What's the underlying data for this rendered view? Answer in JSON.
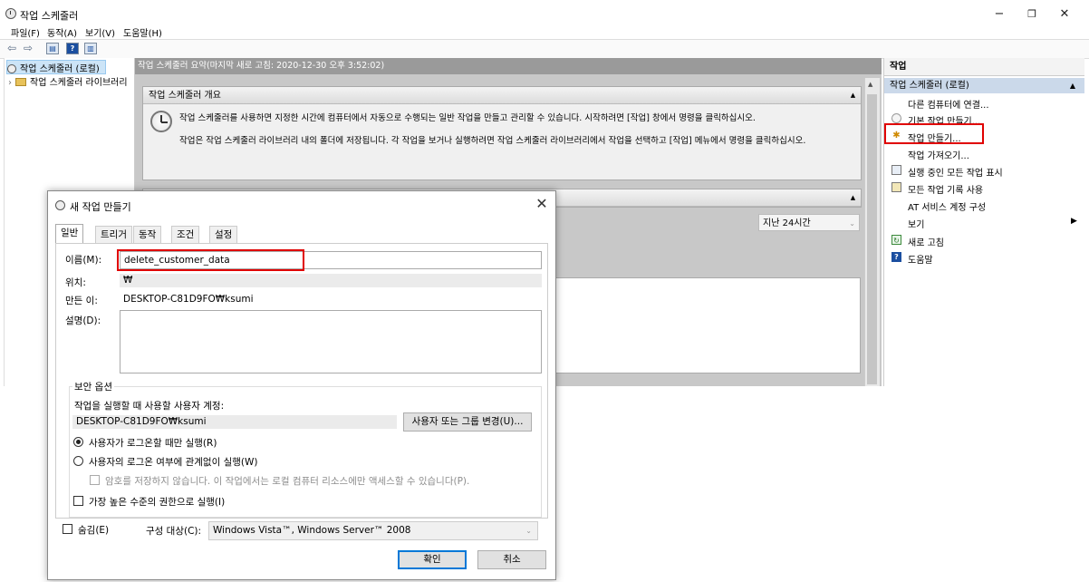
{
  "window": {
    "title": "작업 스케줄러",
    "minimize": "−",
    "restore": "❐",
    "close": "✕"
  },
  "menu": [
    "파일(F)",
    "동작(A)",
    "보기(V)",
    "도움말(H)"
  ],
  "toolbar": {
    "back_icon": "arrow-left",
    "forward_icon": "arrow-right",
    "view_icon": "console-tree",
    "help_icon": "help",
    "panel_icon": "action-pane"
  },
  "tree": {
    "items": [
      {
        "label": "작업 스케줄러 (로컬)",
        "selected": true
      },
      {
        "label": "작업 스케줄러 라이브러리",
        "expander": "›"
      }
    ]
  },
  "center": {
    "header": "작업 스케줄러 요약(마지막 새로 고침: 2020-12-30 오후 3:52:02)",
    "overview": {
      "title": "작업 스케줄러 개요",
      "line1": "작업 스케줄러를 사용하면 지정한 시간에 컴퓨터에서 자동으로 수행되는 일반 작업을 만들고 관리할 수 있습니다. 시작하려면 [작업] 창에서 명령을 클릭하십시오.",
      "line2": "작업은 작업 스케줄러 라이브러리 내의 폴더에 저장됩니다. 각 작업을 보거나 실행하려면 작업 스케줄러 라이브러리에서 작업을 선택하고 [작업] 메뉴에서 명령을 클릭하십시오."
    },
    "period": "지난 24시간",
    "collapse_glyph": "▲"
  },
  "actions": {
    "header": "작업",
    "subheader": "작업 스케줄러 (로컬)",
    "items": [
      {
        "label": "다른 컴퓨터에 연결...",
        "icon": ""
      },
      {
        "label": "기본 작업 만들기...",
        "icon": "basic-task-icon"
      },
      {
        "label": "작업 만들기...",
        "icon": "create-task-icon",
        "highlighted": true
      },
      {
        "label": "작업 가져오기...",
        "icon": ""
      },
      {
        "label": "실행 중인 모든 작업 표시",
        "icon": "running-tasks-icon"
      },
      {
        "label": "모든 작업 기록 사용",
        "icon": "history-icon"
      },
      {
        "label": "AT 서비스 계정 구성",
        "icon": ""
      },
      {
        "label": "보기",
        "icon": "",
        "submenu": "▶"
      },
      {
        "label": "새로 고침",
        "icon": "refresh-icon"
      },
      {
        "label": "도움말",
        "icon": "help-icon"
      }
    ]
  },
  "dialog": {
    "title": "새 작업 만들기",
    "close": "✕",
    "tabs": [
      "일반",
      "트리거",
      "동작",
      "조건",
      "설정"
    ],
    "name_label": "이름(M):",
    "name_value": "delete_customer_data",
    "location_label": "위치:",
    "location_value": "₩",
    "author_label": "만든 이:",
    "author_value": "DESKTOP-C81D9FO₩ksumi",
    "description_label": "설명(D):",
    "description_value": "",
    "security": {
      "title": "보안 옵션",
      "account_label": "작업을 실행할 때 사용할 사용자 계정:",
      "account_value": "DESKTOP-C81D9FO₩ksumi",
      "change_button": "사용자 또는 그룹 변경(U)...",
      "radio_logged_on": "사용자가 로그온할 때만 실행(R)",
      "radio_whether": "사용자의 로그온 여부에 관계없이 실행(W)",
      "no_store_password": "암호를 저장하지 않습니다. 이 작업에서는 로컬 컴퓨터 리소스에만 액세스할 수 있습니다(P).",
      "highest_privileges": "가장 높은 수준의 권한으로 실행(I)"
    },
    "hidden_label": "숨김(E)",
    "configure_label": "구성 대상(C):",
    "configure_value": "Windows Vista™, Windows Server™ 2008",
    "ok": "확인",
    "cancel": "취소"
  },
  "colors": {
    "highlight_red": "#e00000",
    "selection_blue": "#cce4f7",
    "default_button_border": "#0078d7"
  }
}
